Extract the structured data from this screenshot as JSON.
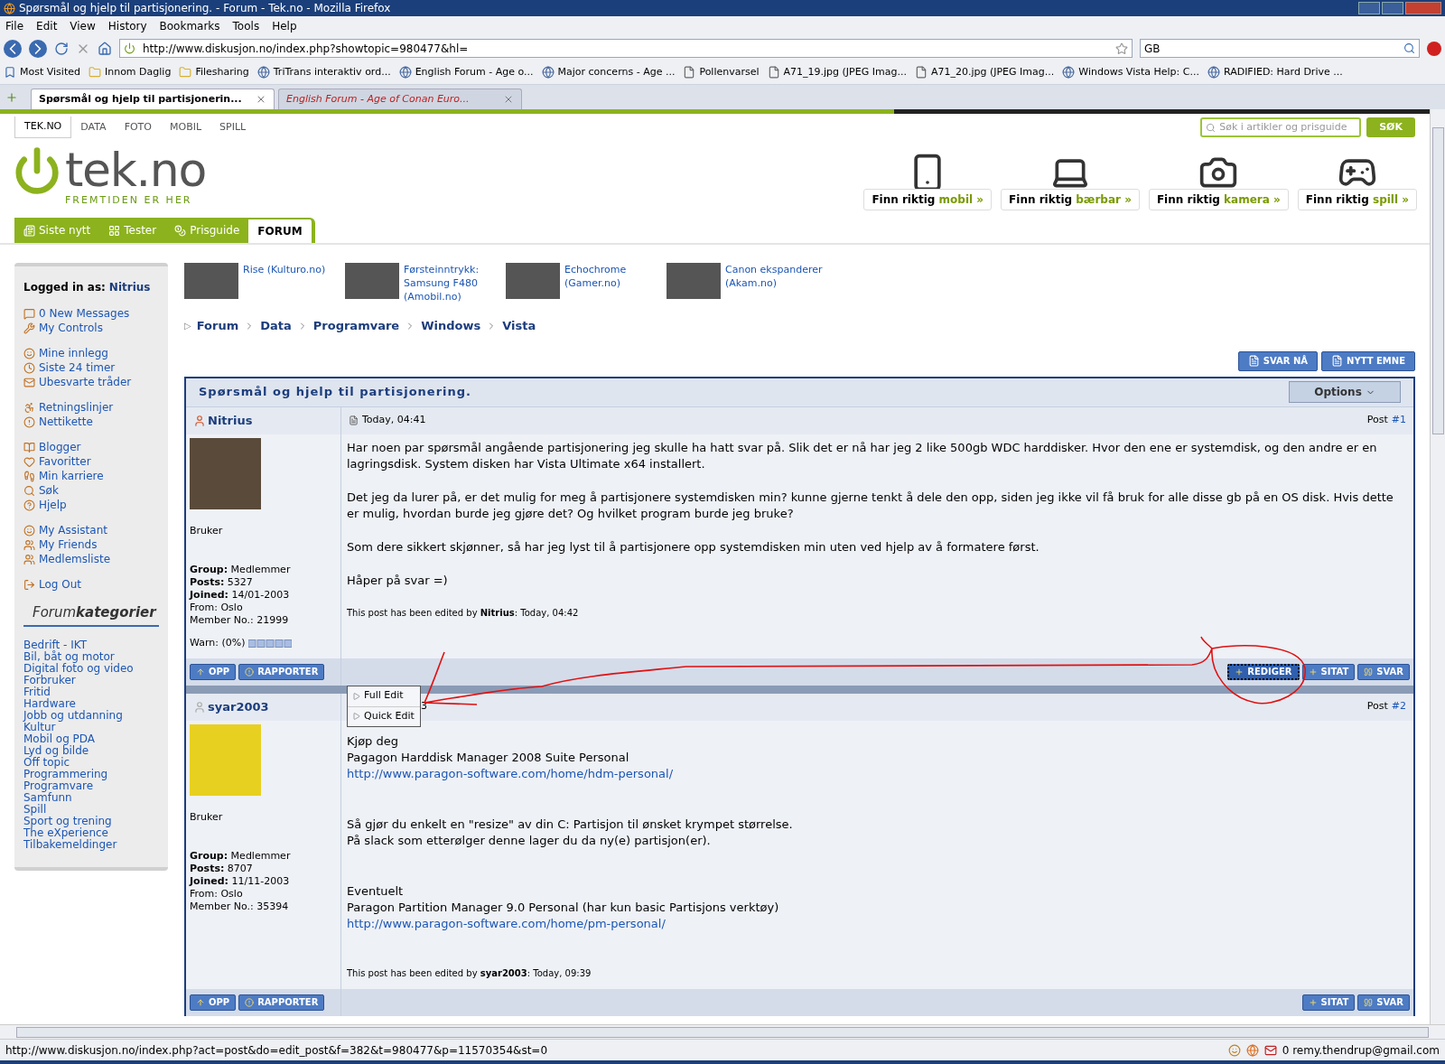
{
  "window": {
    "title": "Spørsmål og hjelp til partisjonering. - Forum - Tek.no - Mozilla Firefox"
  },
  "menu": [
    "File",
    "Edit",
    "View",
    "History",
    "Bookmarks",
    "Tools",
    "Help"
  ],
  "address": {
    "url": "http://www.diskusjon.no/index.php?showtopic=980477&hl="
  },
  "search": {
    "value": "GB"
  },
  "bookmarks": [
    {
      "label": "Most Visited",
      "kind": "smart"
    },
    {
      "label": "Innom Daglig",
      "kind": "folder"
    },
    {
      "label": "Filesharing",
      "kind": "folder"
    },
    {
      "label": "TriTrans interaktiv ord...",
      "kind": "site"
    },
    {
      "label": "English Forum - Age o...",
      "kind": "site"
    },
    {
      "label": "Major concerns - Age ...",
      "kind": "site"
    },
    {
      "label": "Pollenvarsel",
      "kind": "page"
    },
    {
      "label": "A71_19.jpg (JPEG Imag...",
      "kind": "page"
    },
    {
      "label": "A71_20.jpg (JPEG Imag...",
      "kind": "page"
    },
    {
      "label": "Windows Vista Help: C...",
      "kind": "site"
    },
    {
      "label": "RADIFIED: Hard Drive ...",
      "kind": "site"
    }
  ],
  "tabs": [
    {
      "label": "Spørsmål og hjelp til partisjonerin...",
      "selected": true
    },
    {
      "label": "English Forum - Age of Conan Euro...",
      "selected": false
    }
  ],
  "site": {
    "top_nav": [
      {
        "label": "TEK.NO",
        "selected": true
      },
      {
        "label": "DATA",
        "selected": false
      },
      {
        "label": "FOTO",
        "selected": false
      },
      {
        "label": "MOBIL",
        "selected": false
      },
      {
        "label": "SPILL",
        "selected": false
      }
    ],
    "search_placeholder": "Søk i artikler og prisguide",
    "search_button": "SØK",
    "logo": "tek.no",
    "tagline": "FREMTIDEN ER HER",
    "promos": [
      {
        "label": "Finn riktig **mobil »**",
        "kind": "phone"
      },
      {
        "label": "Finn riktig **bærbar »**",
        "kind": "laptop"
      },
      {
        "label": "Finn riktig **kamera »**",
        "kind": "camera"
      },
      {
        "label": "Finn riktig **spill »**",
        "kind": "gamepad"
      }
    ],
    "main_tabs": [
      {
        "label": "Siste nytt",
        "selected": false
      },
      {
        "label": "Tester",
        "selected": false
      },
      {
        "label": "Prisguide",
        "selected": false
      },
      {
        "label": "FORUM",
        "selected": true
      }
    ]
  },
  "sidebar": {
    "logged_in_label": "Logged in as:",
    "user": "Nitrius",
    "groups": [
      [
        "0 New Messages",
        "My Controls"
      ],
      [
        "Mine innlegg",
        "Siste 24 timer",
        "Ubesvarte tråder"
      ],
      [
        "Retningslinjer",
        "Nettikette"
      ],
      [
        "Blogger",
        "Favoritter",
        "Min karriere",
        "Søk",
        "Hjelp"
      ],
      [
        "My Assistant",
        "My Friends",
        "Medlemsliste"
      ],
      [
        "Log Out"
      ]
    ],
    "categories_title": "Forum**kategorier**",
    "categories": [
      "Bedrift - IKT",
      "Bil, båt og motor",
      "Digital foto og video",
      "Forbruker",
      "Fritid",
      "Hardware",
      "Jobb og utdanning",
      "Kultur",
      "Mobil og PDA",
      "Lyd og bilde",
      "Off topic",
      "Programmering",
      "Programvare",
      "Samfunn",
      "Spill",
      "Sport og trening",
      "The eXperience",
      "Tilbakemeldinger"
    ]
  },
  "news": [
    {
      "lines": [
        "Rise (Kulturo.no)"
      ]
    },
    {
      "lines": [
        "Førsteinntrykk:",
        "Samsung F480",
        "(Amobil.no)"
      ]
    },
    {
      "lines": [
        "Echochrome",
        "(Gamer.no)"
      ]
    },
    {
      "lines": [
        "Canon ekspanderer",
        "(Akam.no)"
      ]
    }
  ],
  "breadcrumb_marker": "▷",
  "breadcrumb": [
    "Forum",
    "Data",
    "Programvare",
    "Windows",
    "Vista"
  ],
  "topic_buttons": [
    "SVAR NÅ",
    "NYTT EMNE"
  ],
  "topic": {
    "title": "Spørsmål og hjelp til partisjonering.",
    "options": "Options"
  },
  "posts": [
    {
      "author": "Nitrius",
      "online": true,
      "date": "Today, 04:41",
      "post_label": "Post",
      "post_no": "#1",
      "role": "Bruker",
      "details": [
        "**Group:** Medlemmer",
        "**Posts:** 5327",
        "**Joined:** 14/01-2003",
        "From: Oslo",
        "Member No.: 21999"
      ],
      "warn": "Warn: (0%)",
      "paragraphs": [
        [
          {
            "text": "Har noen par spørsmål angående partisjonering jeg skulle ha hatt svar på. Slik det er nå har jeg 2 like 500gb WDC harddisker. Hvor den ene er systemdisk, og den andre er en lagringsdisk. System disken har Vista Ultimate x64 installert.",
            "kind": "text"
          }
        ],
        [
          {
            "text": "Det jeg da lurer på, er det mulig for meg å partisjonere systemdisken min? kunne gjerne tenkt å dele den opp, siden jeg ikke vil få bruk for alle disse gb på en OS disk. Hvis dette er mulig, hvordan burde jeg gjøre det? Og hvilket program burde jeg bruke?",
            "kind": "text"
          }
        ],
        [
          {
            "text": "Som dere sikkert skjønner, så har jeg lyst til å partisjonere opp systemdisken min uten ved hjelp av å formatere først.",
            "kind": "text"
          }
        ],
        [
          {
            "text": "Håper på svar =)",
            "kind": "text"
          }
        ]
      ],
      "edited": "This post has been edited by **Nitrius**: Today, 04:42",
      "left_buttons": [
        "OPP",
        "RAPPORTER"
      ],
      "right_buttons": [
        {
          "label": "REDIGER",
          "selected": true
        },
        {
          "label": "SITAT",
          "selected": false
        },
        {
          "label": "SVAR",
          "selected": false
        }
      ]
    },
    {
      "author": "syar2003",
      "online": false,
      "date": "3",
      "post_label": "Post",
      "post_no": "#2",
      "role": "Bruker",
      "details": [
        "**Group:** Medlemmer",
        "**Posts:** 8707",
        "**Joined:** 11/11-2003",
        "From: Oslo",
        "Member No.: 35394"
      ],
      "paragraphs": [
        [
          {
            "text": "Kjøp deg",
            "kind": "text"
          },
          {
            "text": "Pagagon Harddisk Manager 2008 Suite Personal",
            "kind": "text"
          },
          {
            "text": "http://www.paragon-software.com/home/hdm-personal/",
            "kind": "link"
          }
        ],
        [
          {
            "text": "Så gjør du enkelt en \"resize\" av din C: Partisjon til ønsket krympet størrelse.",
            "kind": "text"
          },
          {
            "text": "På slack som etterølger denne lager du da ny(e) partisjon(er).",
            "kind": "text"
          }
        ],
        [
          {
            "text": "Eventuelt",
            "kind": "text"
          },
          {
            "text": "Paragon Partition Manager 9.0 Personal (har kun basic Partisjons verktøy)",
            "kind": "text"
          },
          {
            "text": "http://www.paragon-software.com/home/pm-personal/",
            "kind": "link"
          }
        ]
      ],
      "edited": "This post has been edited by **syar2003**: Today, 09:39",
      "left_buttons": [
        "OPP",
        "RAPPORTER"
      ],
      "right_buttons": [
        {
          "label": "SITAT",
          "selected": false
        },
        {
          "label": "SVAR",
          "selected": false
        }
      ]
    }
  ],
  "edit_menu": [
    "Full Edit",
    "Quick Edit"
  ],
  "status_bar": {
    "url": "http://www.diskusjon.no/index.php?act=post&do=edit_post&f=382&t=980477&p=11570354&st=0",
    "mail": "0 remy.thendrup@gmail.com"
  }
}
